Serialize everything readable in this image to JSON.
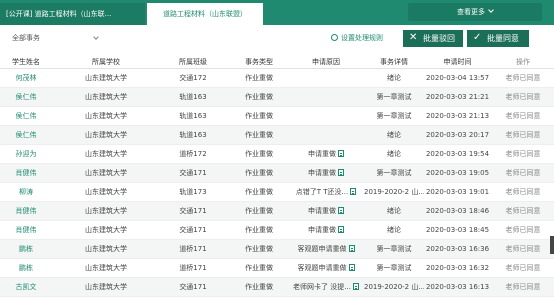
{
  "tabs": [
    {
      "label": "[公开课] 道路工程材料（山东联..."
    },
    {
      "label": "道路工程材料（山东联盟）"
    }
  ],
  "more_label": "查看更多",
  "filter": {
    "selected": "全部事务"
  },
  "settings_label": "设置处理规则",
  "actions": {
    "reject": "批量驳回",
    "approve": "批量同意"
  },
  "columns": [
    "学生姓名",
    "所属学校",
    "所属班级",
    "事务类型",
    "申请原因",
    "事务详情",
    "申请时间",
    "操作"
  ],
  "rows": [
    {
      "name": "何茂林",
      "school": "山东建筑大学",
      "class": "交通172",
      "type": "作业重做",
      "reason": "",
      "detail": "绪论",
      "time": "2020-03-04 13:57",
      "op": "老师已同意"
    },
    {
      "name": "侯仁伟",
      "school": "山东建筑大学",
      "class": "轨道163",
      "type": "作业重做",
      "reason": "",
      "detail": "第一章测试",
      "time": "2020-03-03 21:21",
      "op": "老师已同意"
    },
    {
      "name": "侯仁伟",
      "school": "山东建筑大学",
      "class": "轨道163",
      "type": "作业重做",
      "reason": "",
      "detail": "第一章测试",
      "time": "2020-03-03 21:13",
      "op": "老师已同意"
    },
    {
      "name": "侯仁伟",
      "school": "山东建筑大学",
      "class": "轨道163",
      "type": "作业重做",
      "reason": "",
      "detail": "绪论",
      "time": "2020-03-03 20:17",
      "op": "老师已同意"
    },
    {
      "name": "孙迎为",
      "school": "山东建筑大学",
      "class": "道桥172",
      "type": "作业重做",
      "reason": "申请重做",
      "detail": "绪论",
      "time": "2020-03-03 19:54",
      "op": "老师已同意"
    },
    {
      "name": "肖健伟",
      "school": "山东建筑大学",
      "class": "交通171",
      "type": "作业重做",
      "reason": "申请重做",
      "detail": "第一章测试",
      "time": "2020-03-03 19:05",
      "op": "老师已同意"
    },
    {
      "name": "柳涛",
      "school": "山东建筑大学",
      "class": "轨道173",
      "type": "作业重做",
      "reason": "点错了T T还没...",
      "detail": "2019-2020-2 山...",
      "time": "2020-03-03 19:01",
      "op": "老师已同意"
    },
    {
      "name": "肖健伟",
      "school": "山东建筑大学",
      "class": "交通171",
      "type": "作业重做",
      "reason": "申请重做",
      "detail": "绪论",
      "time": "2020-03-03 18:46",
      "op": "老师已同意"
    },
    {
      "name": "肖健伟",
      "school": "山东建筑大学",
      "class": "交通171",
      "type": "作业重做",
      "reason": "申请重做",
      "detail": "绪论",
      "time": "2020-03-03 18:45",
      "op": "老师已同意"
    },
    {
      "name": "鹏栋",
      "school": "山东建筑大学",
      "class": "道桥171",
      "type": "作业重做",
      "reason": "客观题申请重做",
      "detail": "第一章测试",
      "time": "2020-03-03 16:36",
      "op": "老师已同意"
    },
    {
      "name": "鹏栋",
      "school": "山东建筑大学",
      "class": "道桥171",
      "type": "作业重做",
      "reason": "客观题申请重做",
      "detail": "第一章测试",
      "time": "2020-03-03 16:32",
      "op": "老师已同意"
    },
    {
      "name": "古凯文",
      "school": "山东建筑大学",
      "class": "交通171",
      "type": "作业重做",
      "reason": "老师网卡了 没提...",
      "detail": "2019-2020-2 山...",
      "time": "2020-03-03 16:13",
      "op": "老师已同意"
    }
  ],
  "colors": {
    "primary": "#1f8a6f",
    "dark": "#1b6e58"
  }
}
